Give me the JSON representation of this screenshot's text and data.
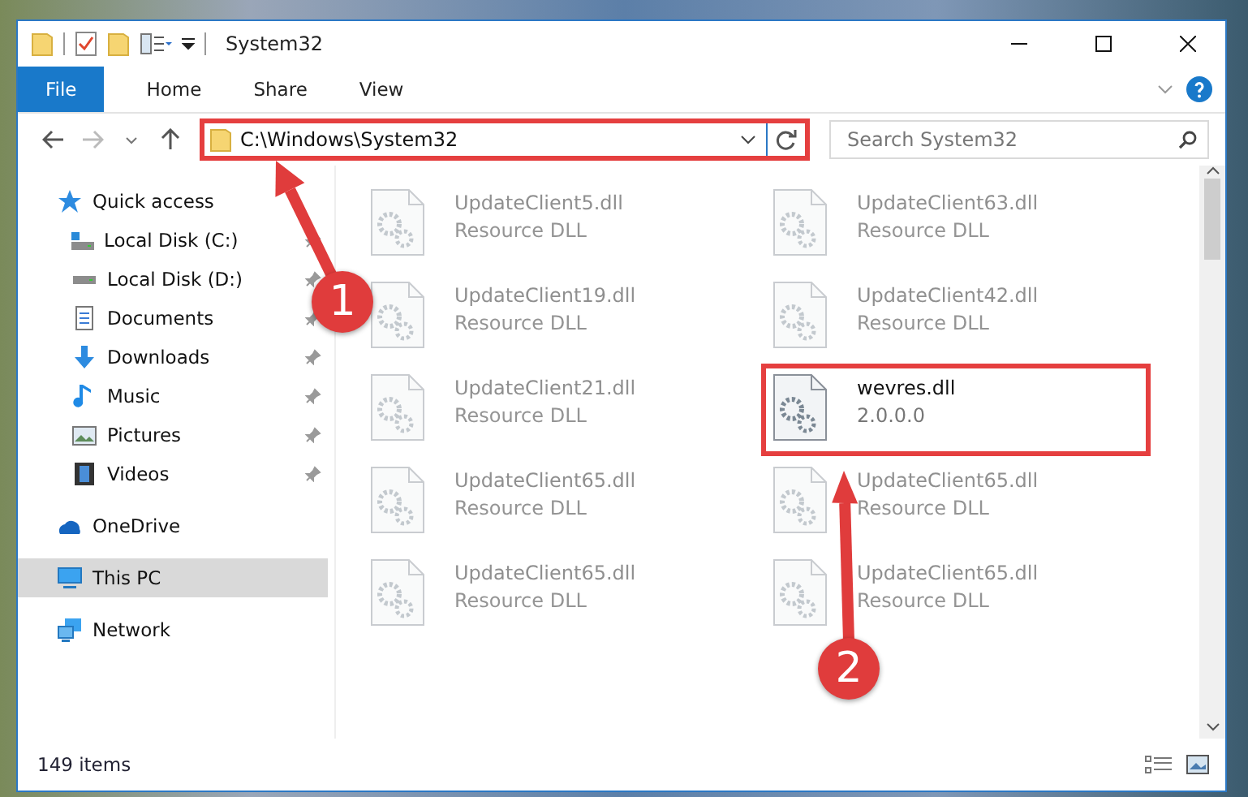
{
  "window": {
    "title": "System32"
  },
  "ribbon_tabs": [
    {
      "label": "File",
      "selected": true
    },
    {
      "label": "Home",
      "selected": false
    },
    {
      "label": "Share",
      "selected": false
    },
    {
      "label": "View",
      "selected": false
    }
  ],
  "address": {
    "value": "C:\\Windows\\System32",
    "highlighted": true
  },
  "search": {
    "placeholder": "Search System32"
  },
  "navigation": [
    {
      "label": "Quick access",
      "selected": false,
      "children": [
        {
          "label": "Local Disk (C:)",
          "pinned": true
        },
        {
          "label": "Local Disk (D:)",
          "pinned": true
        },
        {
          "label": "Documents",
          "pinned": true
        },
        {
          "label": "Downloads",
          "pinned": true
        },
        {
          "label": "Music",
          "pinned": true
        },
        {
          "label": "Pictures",
          "pinned": true
        },
        {
          "label": "Videos",
          "pinned": true
        }
      ]
    },
    {
      "label": "OneDrive",
      "selected": false
    },
    {
      "label": "This PC",
      "selected": true
    },
    {
      "label": "Network",
      "selected": false
    }
  ],
  "files": [
    {
      "name": "UpdateClient5.dll",
      "detail": "Resource DLL",
      "highlighted": false
    },
    {
      "name": "UpdateClient63.dll",
      "detail": "Resource DLL",
      "highlighted": false
    },
    {
      "name": "UpdateClient19.dll",
      "detail": "Resource DLL",
      "highlighted": false
    },
    {
      "name": "UpdateClient42.dll",
      "detail": "Resource DLL",
      "highlighted": false
    },
    {
      "name": "UpdateClient21.dll",
      "detail": "Resource DLL",
      "highlighted": false
    },
    {
      "name": "wevres.dll",
      "detail": "2.0.0.0",
      "highlighted": true
    },
    {
      "name": "UpdateClient65.dll",
      "detail": "Resource DLL",
      "highlighted": false
    },
    {
      "name": "UpdateClient65.dll",
      "detail": "Resource DLL",
      "highlighted": false
    },
    {
      "name": "UpdateClient65.dll",
      "detail": "Resource DLL",
      "highlighted": false
    },
    {
      "name": "UpdateClient65.dll",
      "detail": "Resource DLL",
      "highlighted": false
    }
  ],
  "status_bar": {
    "item_count": "149 items"
  },
  "callouts": [
    {
      "label": "1"
    },
    {
      "label": "2"
    }
  ]
}
